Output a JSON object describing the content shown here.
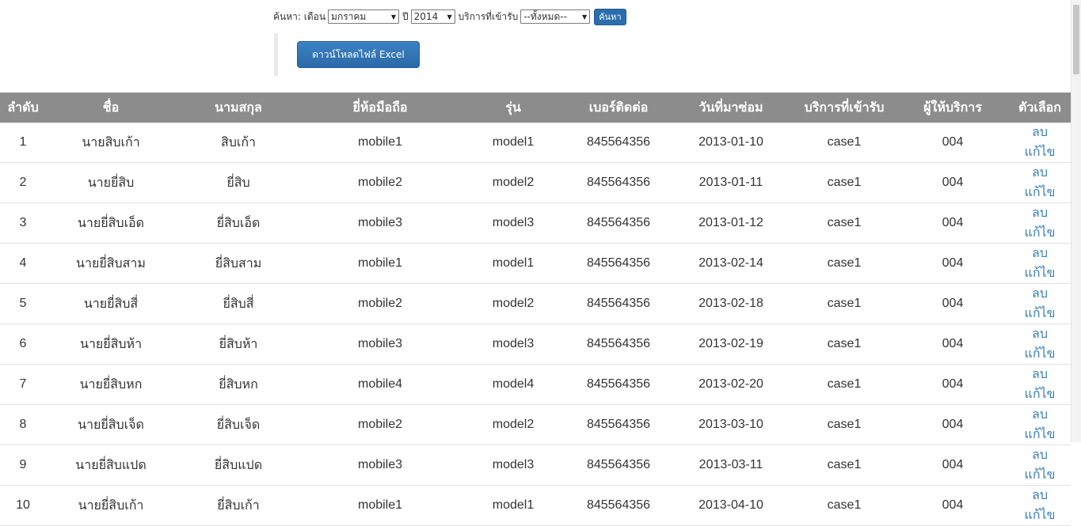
{
  "search": {
    "label": "ค้นหา: เดือน",
    "month_value": "มกราคม",
    "year_label": "ปี",
    "year_value": "2014",
    "service_label": "บริการที่เข้ารับ",
    "service_value": "--ทั้งหมด--",
    "button_label": "ค้นหา"
  },
  "download_button": "ดาวน์โหลดไฟล์ Excel",
  "table": {
    "headers": [
      "ลำดับ",
      "ชื่อ",
      "นามสกุล",
      "ยี่ห้อมือถือ",
      "รุ่น",
      "เบอร์ติดต่อ",
      "วันที่มาซ่อม",
      "บริการที่เข้ารับ",
      "ผู้ให้บริการ",
      "ตัวเลือก"
    ],
    "rows": [
      [
        "1",
        "นายสิบเก้า",
        "สิบเก้า",
        "mobile1",
        "model1",
        "845564356",
        "2013-01-10",
        "case1",
        "004"
      ],
      [
        "2",
        "นายยี่สิบ",
        "ยี่สิบ",
        "mobile2",
        "model2",
        "845564356",
        "2013-01-11",
        "case1",
        "004"
      ],
      [
        "3",
        "นายยี่สิบเอ็ด",
        "ยี่สิบเอ็ด",
        "mobile3",
        "model3",
        "845564356",
        "2013-01-12",
        "case1",
        "004"
      ],
      [
        "4",
        "นายยี่สิบสาม",
        "ยี่สิบสาม",
        "mobile1",
        "model1",
        "845564356",
        "2013-02-14",
        "case1",
        "004"
      ],
      [
        "5",
        "นายยี่สิบสี่",
        "ยี่สิบสี่",
        "mobile2",
        "model2",
        "845564356",
        "2013-02-18",
        "case1",
        "004"
      ],
      [
        "6",
        "นายยี่สิบห้า",
        "ยี่สิบห้า",
        "mobile3",
        "model3",
        "845564356",
        "2013-02-19",
        "case1",
        "004"
      ],
      [
        "7",
        "นายยี่สิบหก",
        "ยี่สิบหก",
        "mobile4",
        "model4",
        "845564356",
        "2013-02-20",
        "case1",
        "004"
      ],
      [
        "8",
        "นายยี่สิบเจ็ด",
        "ยี่สิบเจ็ด",
        "mobile2",
        "model2",
        "845564356",
        "2013-03-10",
        "case1",
        "004"
      ],
      [
        "9",
        "นายยี่สิบแปด",
        "ยี่สิบแปด",
        "mobile3",
        "model3",
        "845564356",
        "2013-03-11",
        "case1",
        "004"
      ],
      [
        "10",
        "นายยี่สิบเก้า",
        "ยี่สิบเก้า",
        "mobile1",
        "model1",
        "845564356",
        "2013-04-10",
        "case1",
        "004"
      ]
    ],
    "action_delete": "ลบ",
    "action_edit": "แก้ไข"
  },
  "colors": {
    "header_bg": "#8c8c8c",
    "link": "#3a7fc1",
    "button_blue": "#2a6ead"
  }
}
